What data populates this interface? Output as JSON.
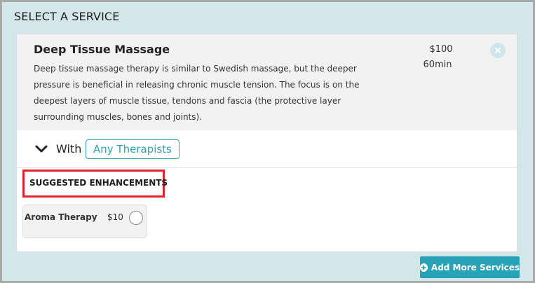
{
  "section": {
    "title": "SELECT A SERVICE"
  },
  "service": {
    "name": "Deep Tissue Massage",
    "description": "Deep tissue massage therapy is similar to Swedish massage, but the deeper pressure is beneficial in releasing chronic muscle tension. The focus is on the deepest layers of muscle tissue, tendons and fascia (the protective layer surrounding muscles, bones and joints).",
    "price": "$100",
    "duration": "60min",
    "remove_icon": "close-icon"
  },
  "therapist": {
    "with_label": "With",
    "selected": "Any Therapists",
    "toggle_icon": "chevron-down-icon"
  },
  "enhancements": {
    "title": "SUGGESTED ENHANCEMENTS",
    "items": [
      {
        "name": "Aroma Therapy",
        "price": "$10",
        "selected": false
      }
    ]
  },
  "actions": {
    "add_more_label": "Add More Services",
    "add_icon": "plus-circle-icon"
  },
  "colors": {
    "accent": "#28a2b6",
    "highlight_border": "#e0232d",
    "background": "#d3e6ea"
  }
}
